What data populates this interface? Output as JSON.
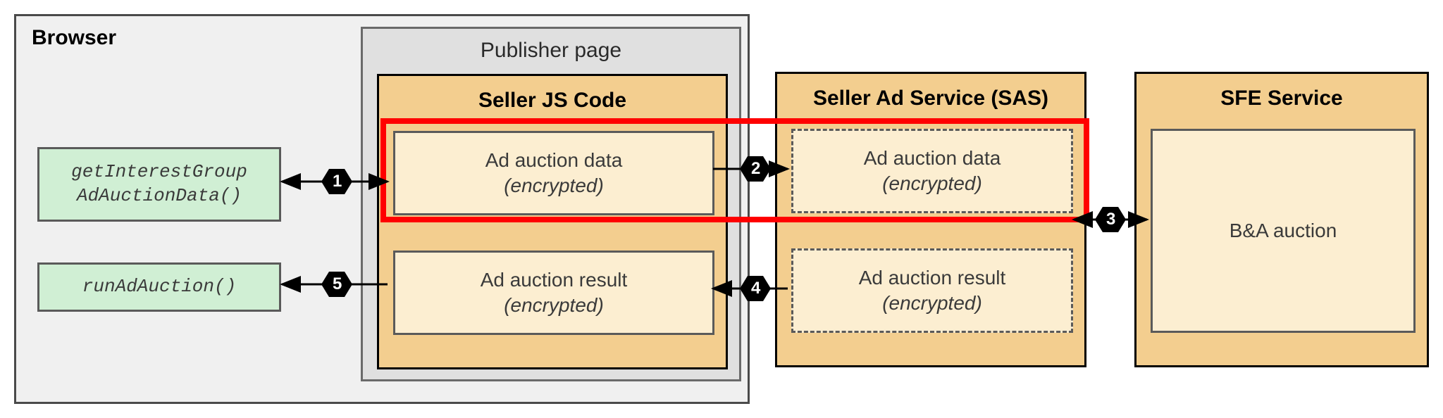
{
  "browser": {
    "label": "Browser",
    "publisher_label": "Publisher page",
    "seller_js_label": "Seller JS Code",
    "api1_line1": "getInterestGroup",
    "api1_line2": "AdAuctionData()",
    "api2": "runAdAuction()",
    "auction_data_label": "Ad auction data",
    "auction_result_label": "Ad auction result",
    "encrypted": "(encrypted)"
  },
  "sas": {
    "label": "Seller Ad Service (SAS)"
  },
  "sfe": {
    "label": "SFE Service",
    "ba_label": "B&A auction"
  },
  "steps": {
    "s1": "1",
    "s2": "2",
    "s3": "3",
    "s4": "4",
    "s5": "5"
  }
}
